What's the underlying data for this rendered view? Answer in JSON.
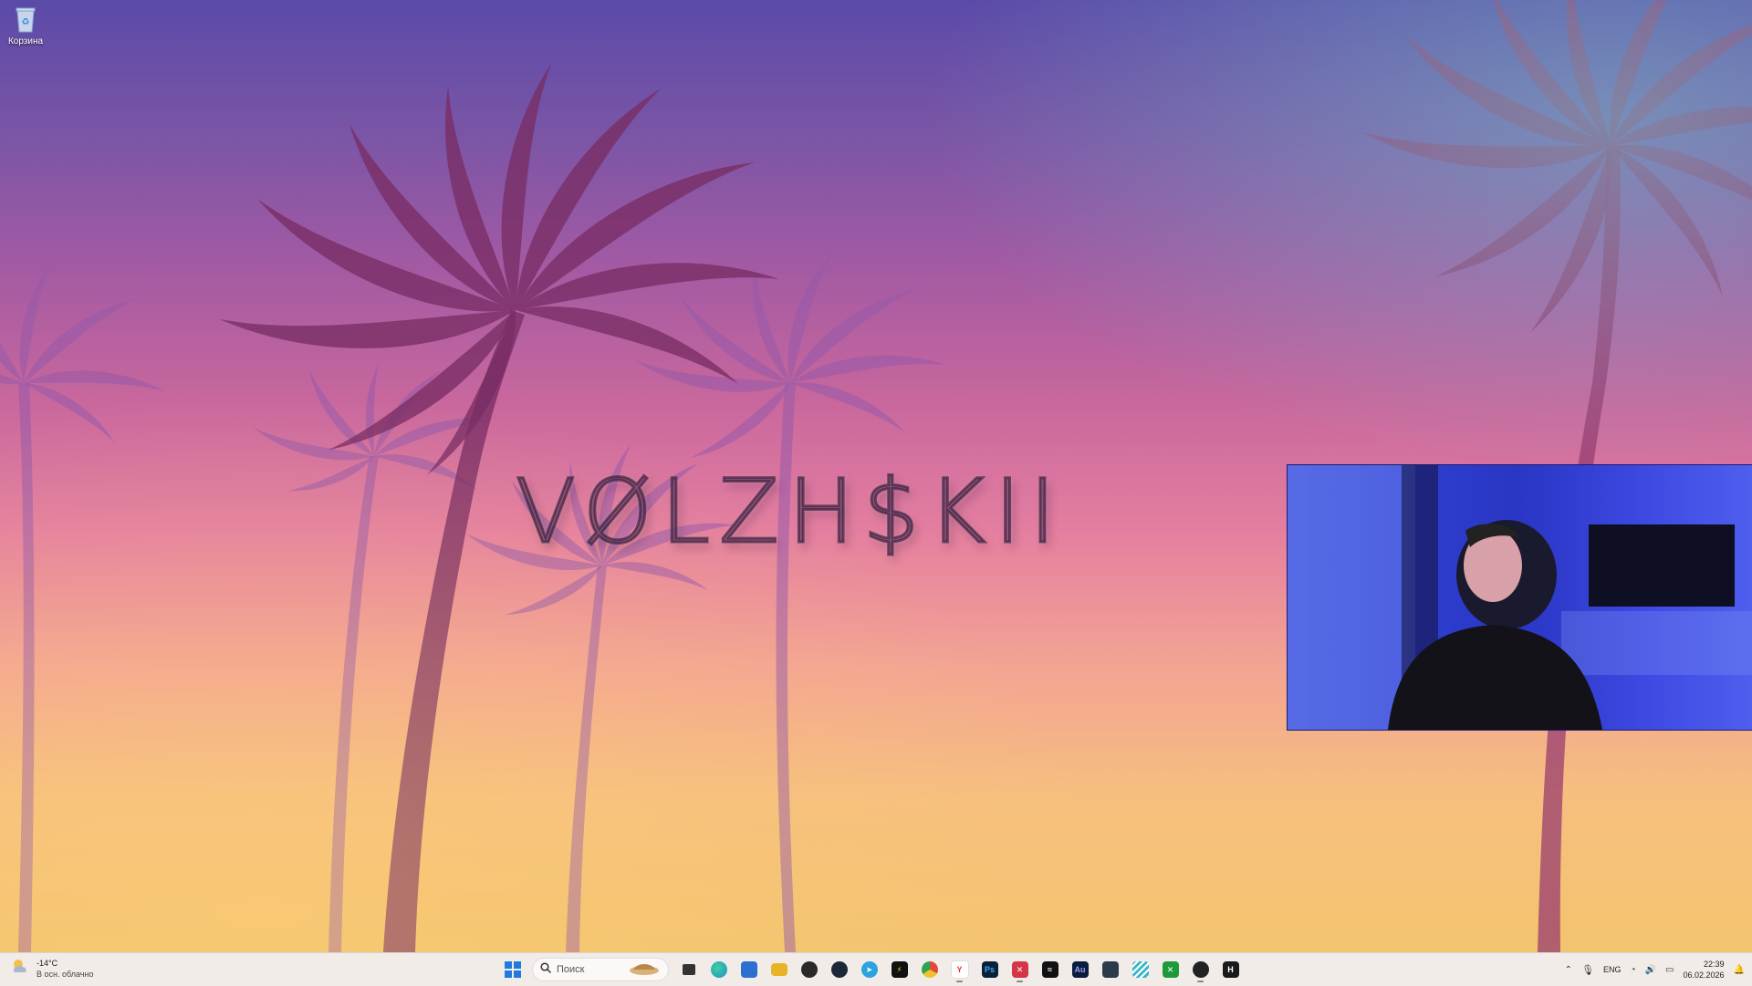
{
  "desktop": {
    "icons": [
      {
        "label": "Корзина",
        "icon": "recycle-bin-icon"
      }
    ],
    "wallpaper_text": "VØLZH$KII"
  },
  "taskbar": {
    "weather": {
      "temp": "-14°C",
      "condition": "В осн. облачно",
      "icon": "partly-cloudy-icon"
    },
    "search_placeholder": "Поиск",
    "apps": [
      {
        "name": "start",
        "icon": "windows-start-icon",
        "color": "#1f7ae0"
      },
      {
        "name": "task-view",
        "icon": "task-view-icon",
        "color": "#333333"
      },
      {
        "name": "edge",
        "icon": "edge-icon",
        "color": "#1e8fc7"
      },
      {
        "name": "store",
        "icon": "store-icon",
        "color": "#2b6fd1"
      },
      {
        "name": "file-explorer",
        "icon": "folder-icon",
        "color": "#e8b324"
      },
      {
        "name": "obs",
        "icon": "obs-icon",
        "color": "#2a2a2a"
      },
      {
        "name": "steam",
        "icon": "steam-icon",
        "color": "#1b2838"
      },
      {
        "name": "telegram",
        "icon": "telegram-icon",
        "color": "#2aa3df"
      },
      {
        "name": "app-yellow",
        "icon": "bolt-icon",
        "color": "#111111"
      },
      {
        "name": "chrome",
        "icon": "chrome-icon",
        "color": "#e04a3a"
      },
      {
        "name": "yandex-browser",
        "icon": "yandex-icon",
        "color": "#ffffff"
      },
      {
        "name": "photoshop",
        "icon": "photoshop-icon",
        "color": "#0b2138",
        "text": "Ps"
      },
      {
        "name": "app-x",
        "icon": "x-app-icon",
        "color": "#d63447"
      },
      {
        "name": "capcut",
        "icon": "capcut-icon",
        "color": "#111111"
      },
      {
        "name": "audition",
        "icon": "audition-icon",
        "color": "#0a1d3d",
        "text": "Au"
      },
      {
        "name": "davinci",
        "icon": "davinci-icon",
        "color": "#2b3b4a"
      },
      {
        "name": "app-stripes",
        "icon": "stripes-icon",
        "color": "#3ab6c7"
      },
      {
        "name": "xbox",
        "icon": "xbox-icon",
        "color": "#1e9a3a"
      },
      {
        "name": "app-record",
        "icon": "record-icon",
        "color": "#222222"
      },
      {
        "name": "app-h",
        "icon": "h-app-icon",
        "color": "#1a1a1a",
        "text": "H"
      }
    ],
    "tray": {
      "lang": "ENG",
      "time": "22:39",
      "date": "06.02.2026"
    }
  }
}
